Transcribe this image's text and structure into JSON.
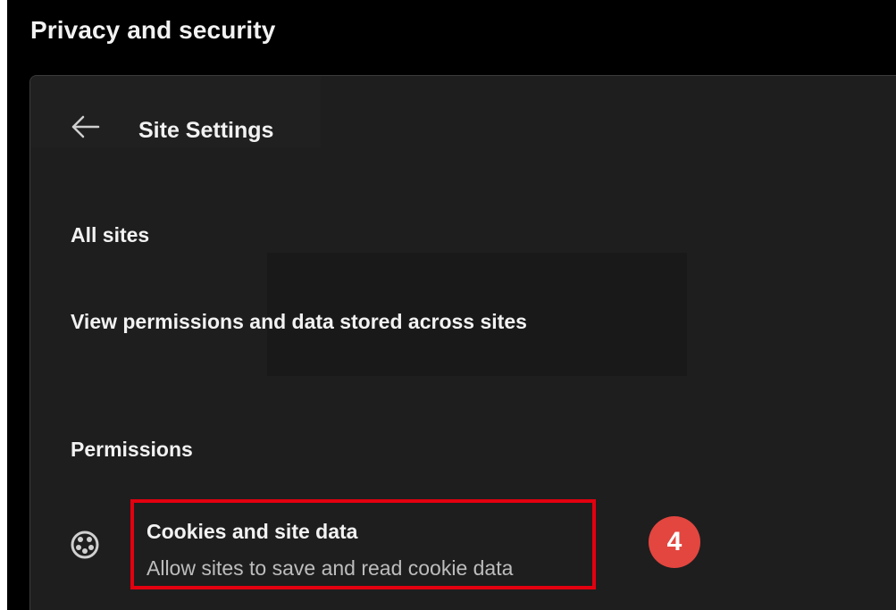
{
  "header": {
    "title": "Privacy and security"
  },
  "site_settings": {
    "back_icon": "arrow-left-icon",
    "title": "Site Settings",
    "all_sites_label": "All sites",
    "view_permissions_label": "View permissions and data stored across sites",
    "permissions_heading": "Permissions",
    "cookies": {
      "icon": "cookie-icon",
      "title": "Cookies and site data",
      "description": "Allow sites to save and read cookie data"
    }
  },
  "annotation": {
    "step_number": "4",
    "highlight_color": "#e3000f",
    "badge_color": "#e2463f"
  },
  "colors": {
    "background": "#000000",
    "card": "#1e1e1e",
    "text_primary": "#f2f2f2",
    "text_secondary": "#bdbdbd"
  }
}
